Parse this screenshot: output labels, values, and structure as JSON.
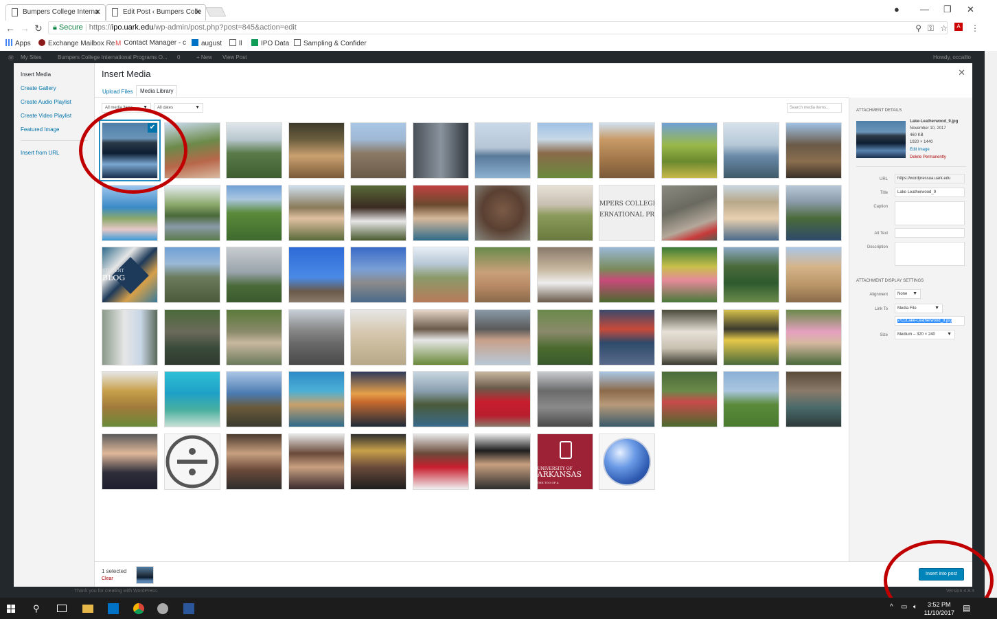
{
  "browser": {
    "tabs": [
      {
        "label": "Bumpers College Interna"
      },
      {
        "label": "Edit Post ‹ Bumpers Colle"
      }
    ],
    "secure_label": "Secure",
    "url_scheme": "https://",
    "url_host": "ipo.uark.edu",
    "url_rest": "/wp-admin/post.php?post=845&action=edit",
    "bookmarks": [
      "Apps",
      "Exchange Mailbox Re",
      "Contact Manager - c",
      "august",
      "ll",
      "IPO Data",
      "Sampling & Confider"
    ]
  },
  "wp_admin_bar": {
    "items": [
      "My Sites",
      "Bumpers College International Programs O...",
      "0",
      "+ New",
      "View Post"
    ],
    "howdy": "Howdy, occaillo"
  },
  "media_modal": {
    "menu": [
      "Insert Media",
      "Create Gallery",
      "Create Audio Playlist",
      "Create Video Playlist",
      "Featured Image",
      "Insert from URL"
    ],
    "title": "Insert Media",
    "tabs": [
      "Upload Files",
      "Media Library"
    ],
    "filters": {
      "type": "All media items",
      "date": "All dates"
    },
    "search_placeholder": "Search media items...",
    "captions": {
      "college_top": "MPERS COLLEGE",
      "college_bottom": "ERNATIONAL PROGR",
      "blog_top": "STUDENT",
      "blog_bottom": "BLOG",
      "arkansas_top": "UNIVERSITY OF",
      "arkansas_main": "ARKANSAS",
      "arkansas_sub": "THE TOO OF A"
    },
    "details": {
      "heading": "Attachment Details",
      "filename": "Lake-Leatherwood_9.jpg",
      "date": "November 10, 2017",
      "size": "460 KB",
      "dimensions": "1920 × 1440",
      "edit_label": "Edit Image",
      "delete_label": "Delete Permanently",
      "url_label": "URL",
      "url_value": "https://wordpressua.uark.edu",
      "title_label": "Title",
      "title_value": "Lake Leatherwood_9",
      "caption_label": "Caption",
      "alt_label": "Alt Text",
      "description_label": "Description"
    },
    "display": {
      "heading": "Attachment Display Settings",
      "alignment_label": "Alignment",
      "alignment_value": "None",
      "linkto_label": "Link To",
      "linkto_value": "Media File",
      "link_url": "7/11/Lake-Leatherwood_9.jpg",
      "size_label": "Size",
      "size_value": "Medium – 320 × 240"
    },
    "toolbar": {
      "selected_count": "1 selected",
      "clear_label": "Clear",
      "insert_label": "Insert into post"
    }
  },
  "footer": {
    "thanks": "Thank you for creating with WordPress.",
    "version": "Version 4.8.3"
  },
  "taskbar": {
    "time": "3:52 PM",
    "date": "11/10/2017"
  },
  "colors": {
    "accent": "#0073aa",
    "button": "#0085ba",
    "annotation": "#c00000"
  }
}
